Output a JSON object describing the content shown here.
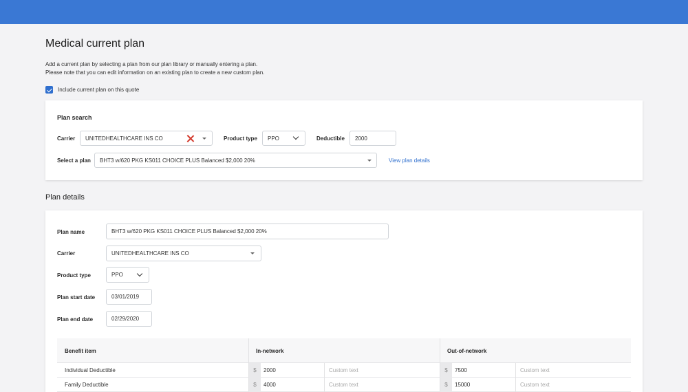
{
  "page": {
    "title": "Medical current plan",
    "desc_line1": "Add a current plan by selecting a plan from our plan library or manually entering a plan.",
    "desc_line2": "Please note that you can edit information on an existing plan to create a new custom plan.",
    "include_label": "Include current plan on this quote",
    "include_checked": true
  },
  "plan_search": {
    "title": "Plan search",
    "carrier_label": "Carrier",
    "carrier_value": "UNITEDHEALTHCARE INS CO",
    "product_type_label": "Product type",
    "product_type_value": "PPO",
    "deductible_label": "Deductible",
    "deductible_value": "2000",
    "select_plan_label": "Select a plan",
    "select_plan_value": "BHT3 w/620 PKG KS011 CHOICE PLUS Balanced $2,000 20%",
    "view_details_link": "View plan details"
  },
  "plan_details": {
    "title": "Plan details",
    "plan_name_label": "Plan name",
    "plan_name_value": "BHT3 w/620 PKG KS011 CHOICE PLUS Balanced $2,000 20%",
    "carrier_label": "Carrier",
    "carrier_value": "UNITEDHEALTHCARE INS CO",
    "product_type_label": "Product type",
    "product_type_value": "PPO",
    "start_label": "Plan start date",
    "start_value": "03/01/2019",
    "end_label": "Plan end date",
    "end_value": "02/29/2020"
  },
  "benefits": {
    "headers": [
      "Benefit item",
      "In-network",
      "Out-of-network"
    ],
    "currency": "$",
    "custom_placeholder": "Custom text",
    "rows": [
      {
        "item": "Individual Deductible",
        "in": "2000",
        "out": "7500"
      },
      {
        "item": "Family Deductible",
        "in": "4000",
        "out": "15000"
      }
    ]
  },
  "colors": {
    "header": "#3a78d4",
    "accent": "#2f6fce",
    "clear": "#d33b2e"
  },
  "icons": [
    "checkbox-checked-icon",
    "clear-x-icon",
    "caret-down-icon",
    "chevron-down-icon"
  ]
}
